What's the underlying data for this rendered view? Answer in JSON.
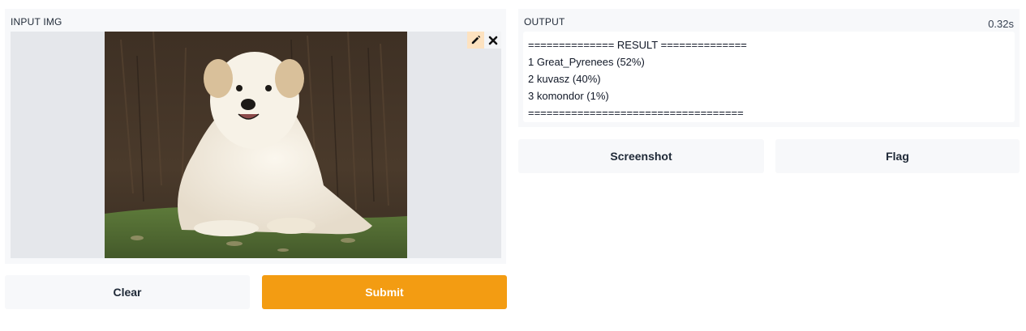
{
  "input": {
    "label": "INPUT IMG",
    "image_subject": "white fluffy dog lying on grass",
    "tools": [
      {
        "icon": "pencil-icon"
      },
      {
        "icon": "close-icon"
      }
    ]
  },
  "output": {
    "label": "OUTPUT",
    "timer": "0.32s",
    "lines": [
      "============== RESULT ==============",
      "1 Great_Pyrenees (52%)",
      "2 kuvasz (40%)",
      "3 komondor (1%)",
      "==================================="
    ]
  },
  "buttons": {
    "clear": "Clear",
    "submit": "Submit",
    "screenshot": "Screenshot",
    "flag": "Flag"
  },
  "colors": {
    "accent": "#f39c12",
    "panel_bg": "#f7f8fa",
    "image_bg": "#e5e7eb"
  }
}
